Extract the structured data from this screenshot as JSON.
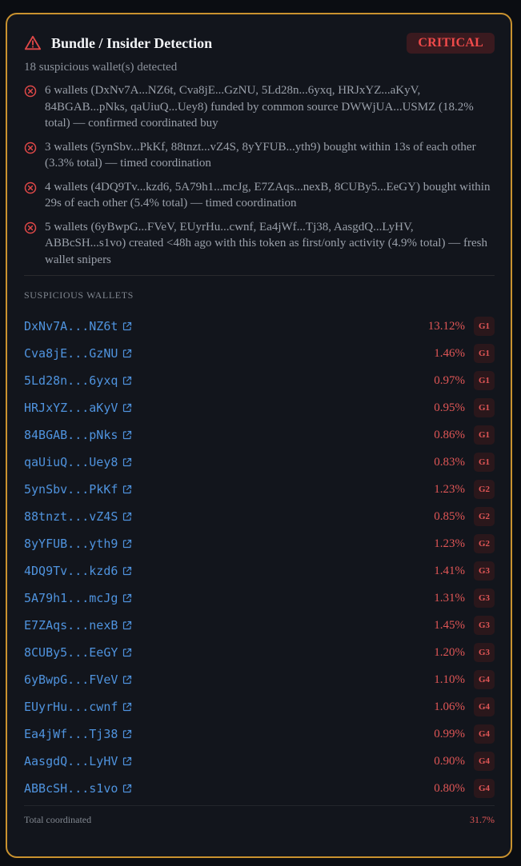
{
  "header": {
    "title": "Bundle / Insider Detection",
    "severity": "CRITICAL",
    "summary": "18 suspicious wallet(s) detected"
  },
  "colors": {
    "border_accent": "#c9922f",
    "danger": "#e05656",
    "link": "#4f93de"
  },
  "findings": [
    "6 wallets (DxNv7A...NZ6t, Cva8jE...GzNU, 5Ld28n...6yxq, HRJxYZ...aKyV, 84BGAB...pNks, qaUiuQ...Uey8) funded by common source DWWjUA...USMZ (18.2% total) — confirmed coordinated buy",
    "3 wallets (5ynSbv...PkKf, 88tnzt...vZ4S, 8yYFUB...yth9) bought within 13s of each other (3.3% total) — timed coordination",
    "4 wallets (4DQ9Tv...kzd6, 5A79h1...mcJg, E7ZAqs...nexB, 8CUBy5...EeGY) bought within 29s of each other (5.4% total) — timed coordination",
    "5 wallets (6yBwpG...FVeV, EUyrHu...cwnf, Ea4jWf...Tj38, AasgdQ...LyHV, ABBcSH...s1vo) created <48h ago with this token as first/only activity (4.9% total) — fresh wallet snipers"
  ],
  "wallets_section": {
    "label": "SUSPICIOUS WALLETS",
    "wallets": [
      {
        "address": "DxNv7A...NZ6t",
        "pct": "13.12%",
        "group": "G1"
      },
      {
        "address": "Cva8jE...GzNU",
        "pct": "1.46%",
        "group": "G1"
      },
      {
        "address": "5Ld28n...6yxq",
        "pct": "0.97%",
        "group": "G1"
      },
      {
        "address": "HRJxYZ...aKyV",
        "pct": "0.95%",
        "group": "G1"
      },
      {
        "address": "84BGAB...pNks",
        "pct": "0.86%",
        "group": "G1"
      },
      {
        "address": "qaUiuQ...Uey8",
        "pct": "0.83%",
        "group": "G1"
      },
      {
        "address": "5ynSbv...PkKf",
        "pct": "1.23%",
        "group": "G2"
      },
      {
        "address": "88tnzt...vZ4S",
        "pct": "0.85%",
        "group": "G2"
      },
      {
        "address": "8yYFUB...yth9",
        "pct": "1.23%",
        "group": "G2"
      },
      {
        "address": "4DQ9Tv...kzd6",
        "pct": "1.41%",
        "group": "G3"
      },
      {
        "address": "5A79h1...mcJg",
        "pct": "1.31%",
        "group": "G3"
      },
      {
        "address": "E7ZAqs...nexB",
        "pct": "1.45%",
        "group": "G3"
      },
      {
        "address": "8CUBy5...EeGY",
        "pct": "1.20%",
        "group": "G3"
      },
      {
        "address": "6yBwpG...FVeV",
        "pct": "1.10%",
        "group": "G4"
      },
      {
        "address": "EUyrHu...cwnf",
        "pct": "1.06%",
        "group": "G4"
      },
      {
        "address": "Ea4jWf...Tj38",
        "pct": "0.99%",
        "group": "G4"
      },
      {
        "address": "AasgdQ...LyHV",
        "pct": "0.90%",
        "group": "G4"
      },
      {
        "address": "ABBcSH...s1vo",
        "pct": "0.80%",
        "group": "G4"
      }
    ]
  },
  "footer": {
    "label": "Total coordinated",
    "value": "31.7%"
  },
  "icons": {
    "header": "warning-triangle-icon",
    "finding": "x-circle-icon",
    "wallet_link": "external-link-icon"
  }
}
